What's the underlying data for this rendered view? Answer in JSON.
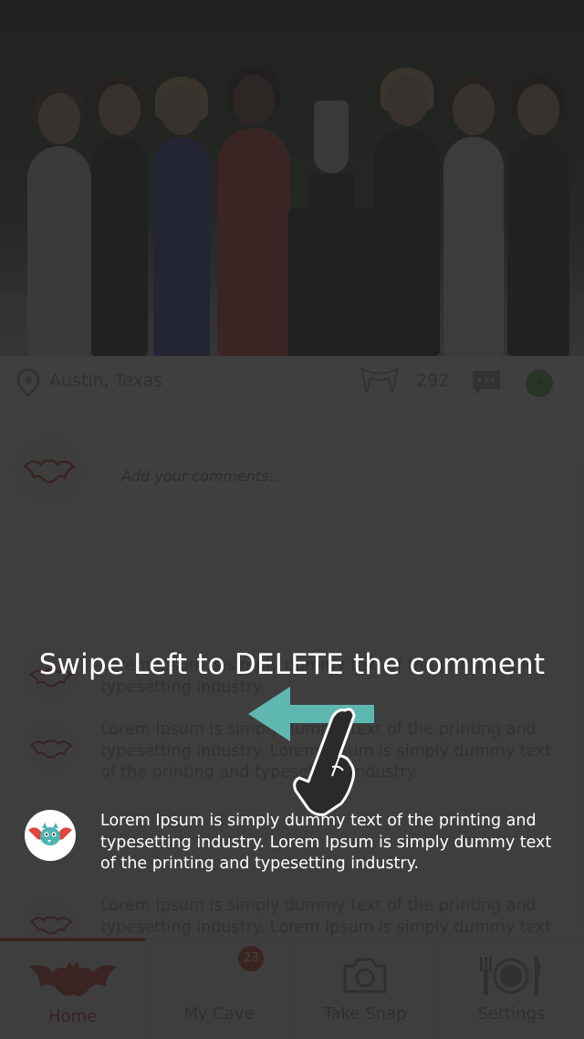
{
  "post": {
    "location": "Austin, Texas",
    "fang_count": "292",
    "comment_badge": "4"
  },
  "compose": {
    "placeholder": "Add your comments..."
  },
  "comments": [
    {
      "text": "Lorem Ipsum is simply dummy text of the printing and typesetting industry."
    },
    {
      "text": "Lorem Ipsum is simply dummy text of the printing and typesetting industry. Lorem Ipsum is simply dummy text of the printing and typesetting industry."
    },
    {
      "text": "Lorem Ipsum is simply dummy text of the printing and typesetting industry. Lorem Ipsum is simply dummy text of the printing and typesetting industry."
    },
    {
      "text": "Lorem Ipsum is simply dummy text of the printing and typesetting industry. Lorem Ipsum is simply dummy text"
    }
  ],
  "tutorial": {
    "message": "Swipe Left to DELETE the comment"
  },
  "tabs": [
    {
      "label": "Home",
      "icon": "bat-icon",
      "active": true
    },
    {
      "label": "My Cave",
      "icon": "cave-icon",
      "badge": "23"
    },
    {
      "label": "Take Snap",
      "icon": "camera-icon"
    },
    {
      "label": "Settings",
      "icon": "cutlery-plate-icon"
    }
  ],
  "colors": {
    "accent": "#d9302c",
    "overlay": "#222222",
    "arrow": "#5fb8b0",
    "badge_green": "#4caf50"
  }
}
